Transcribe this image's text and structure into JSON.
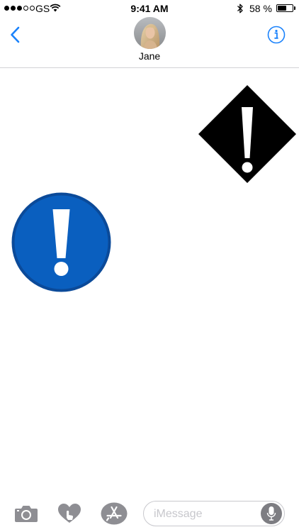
{
  "status_bar": {
    "signal_bars_filled": 3,
    "signal_bars_total": 5,
    "carrier": "GS",
    "time": "9:41 AM",
    "battery_text": "58 %",
    "battery_level": 0.58
  },
  "nav": {
    "contact_name": "Jane"
  },
  "messages": {
    "stickers": [
      {
        "kind": "warning-diamond",
        "color": "#000000"
      },
      {
        "kind": "exclamation-circle",
        "color": "#0a5fbf"
      }
    ]
  },
  "input_bar": {
    "placeholder": "iMessage"
  },
  "colors": {
    "accent": "#1a82fb",
    "tool_gray": "#8e8e93",
    "sticker_blue": "#0a5fbf",
    "sticker_blue_edge": "#0b4a99"
  }
}
